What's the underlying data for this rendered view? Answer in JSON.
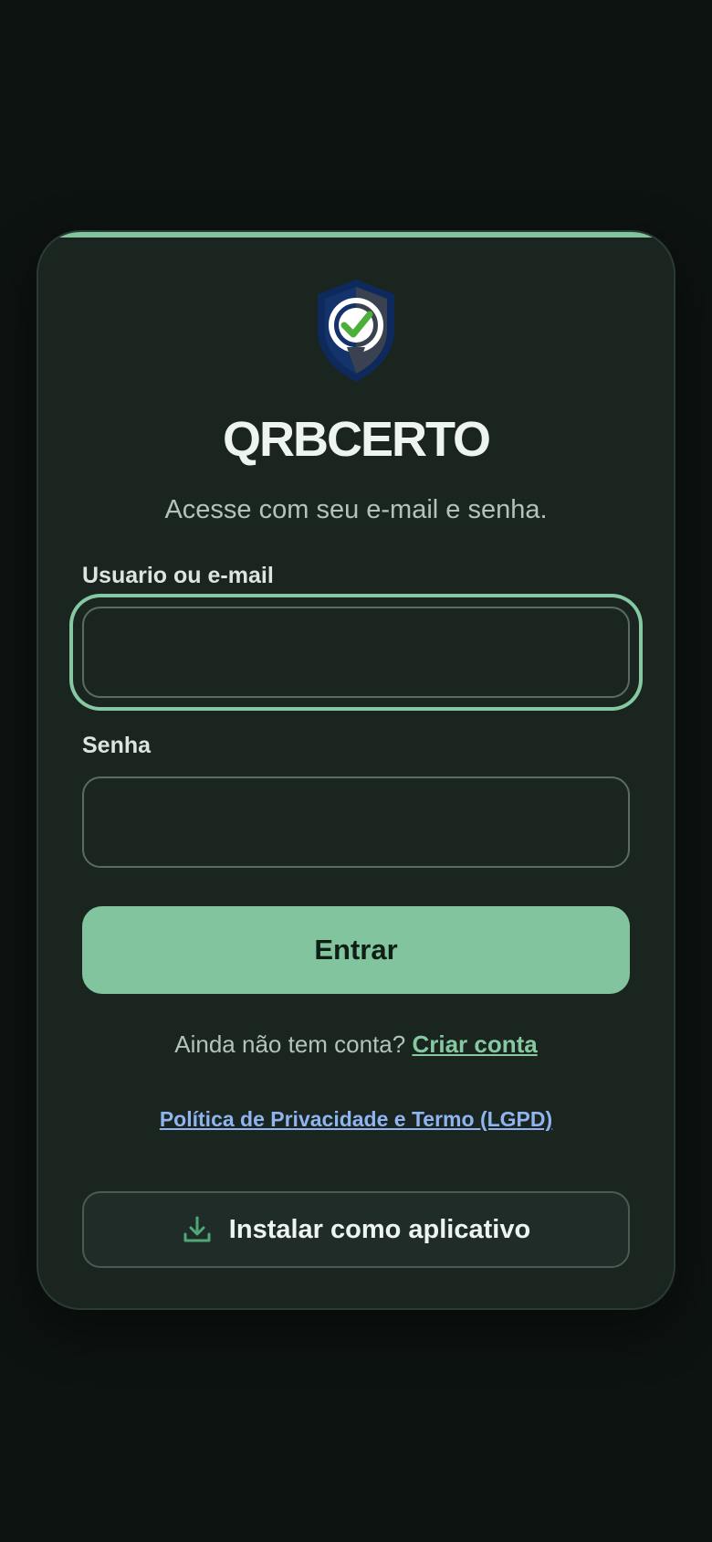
{
  "brand": {
    "name": "QRBCERTO",
    "subtitle": "Acesse com seu e-mail e senha."
  },
  "form": {
    "user_label": "Usuario ou e-mail",
    "user_value": "",
    "password_label": "Senha",
    "password_value": "",
    "submit_label": "Entrar"
  },
  "signup": {
    "prompt": "Ainda não tem conta?",
    "link_label": "Criar conta"
  },
  "privacy": {
    "link_label": "Política de Privacidade e Termo (LGPD)"
  },
  "install": {
    "label": "Instalar como aplicativo",
    "icon": "download-icon"
  },
  "colors": {
    "background": "#0d1311",
    "card": "#1a2520",
    "accent": "#82c49e",
    "link_blue": "#8fb4f0",
    "logo_navy": "#0e2a5c",
    "logo_check": "#4caf3a"
  }
}
